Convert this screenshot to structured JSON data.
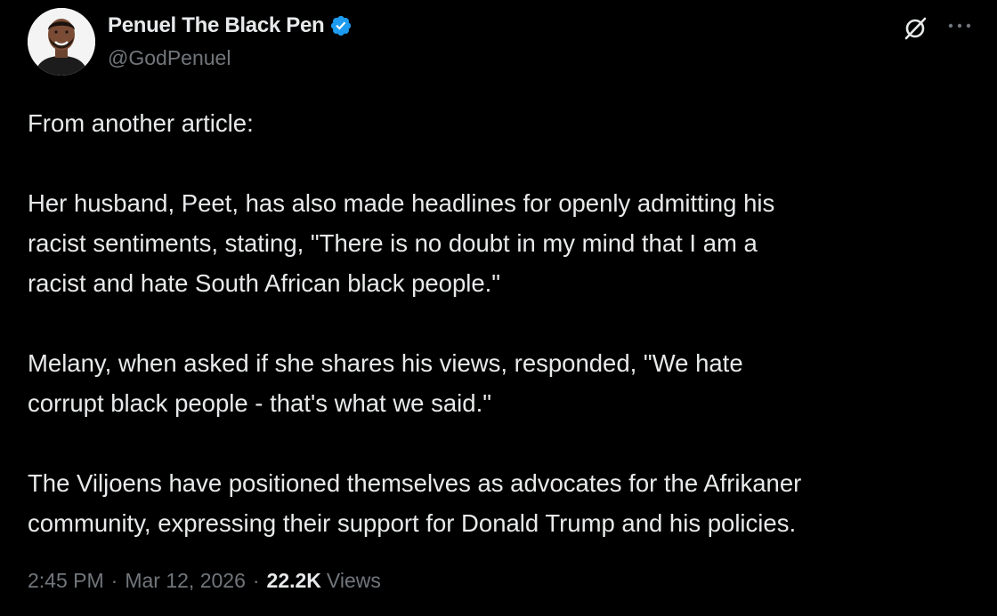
{
  "author": {
    "display_name": "Penuel The Black Pen",
    "handle": "@GodPenuel",
    "verified": true,
    "verified_color": "#1d9bf0"
  },
  "actions": {
    "grok_icon": "grok-icon",
    "more_icon": "more-icon"
  },
  "tweet": {
    "paragraphs": [
      "From another article:",
      "Her husband, Peet, has also made headlines for openly admitting his\nracist sentiments, stating, \"There is no doubt in my mind that I am a\nracist and hate South African black people.\"",
      "Melany, when asked if she shares his views, responded, \"We hate\ncorrupt black people - that's what we said.\"",
      "The Viljoens have positioned themselves as advocates for the Afrikaner\ncommunity, expressing their support for Donald Trump and his policies."
    ]
  },
  "meta": {
    "time": "2:45 PM",
    "separator": "·",
    "date": "Mar 12, 2026",
    "views_count": "22.2K",
    "views_label": "Views"
  },
  "colors": {
    "background": "#000000",
    "primary_text": "#e7e9ea",
    "secondary_text": "#71767b"
  }
}
